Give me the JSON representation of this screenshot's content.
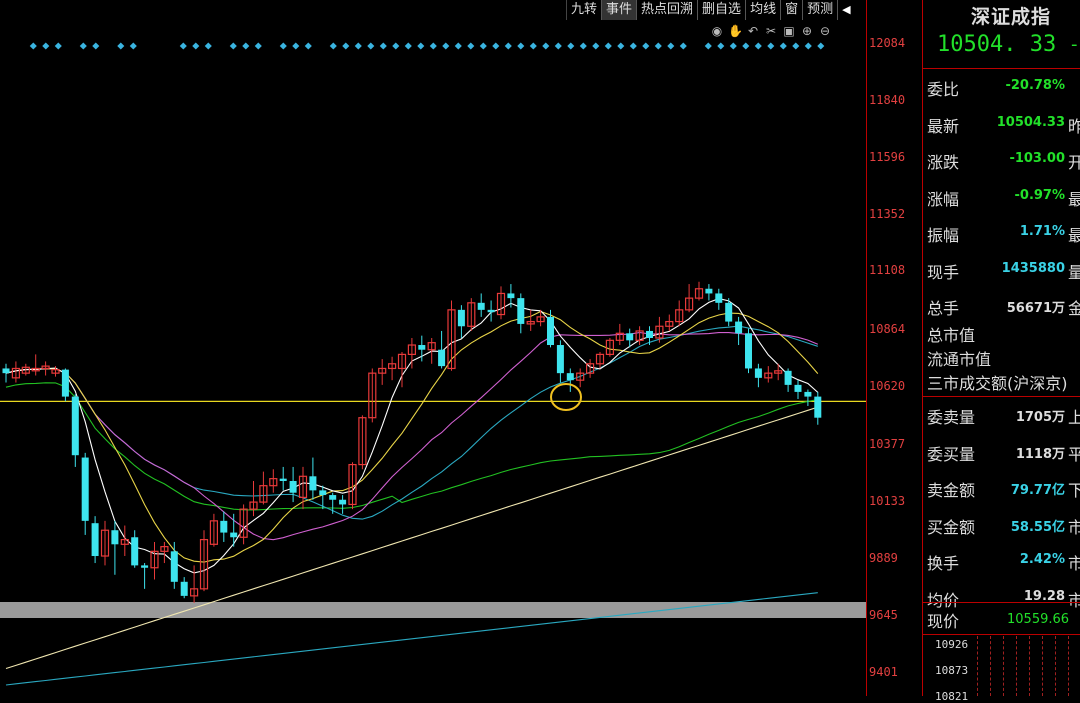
{
  "toolbar": {
    "buttons": [
      "九转",
      "事件",
      "热点回溯",
      "删自选",
      "均线",
      "窗",
      "预测"
    ],
    "active_index": 1,
    "collapse_label": "◀"
  },
  "tools": [
    "eye-icon",
    "hand-icon",
    "undo-icon",
    "scissors-icon",
    "lock-icon",
    "zoom-in-icon",
    "zoom-out-icon"
  ],
  "colors": {
    "up": "#e83a3a",
    "down": "#3ee4ee",
    "ma5": "#ffffff",
    "ma10": "#e8d448",
    "ma20": "#d060d0",
    "ma60": "#22c022",
    "ma120": "#2aa8c0",
    "ma250": "#f0e6b0",
    "ref": "#e8d820"
  },
  "chart_data": {
    "type": "candlestick",
    "y_ticks": [
      "12084",
      "11840",
      "11596",
      "11352",
      "11108",
      "10864",
      "10620",
      "10377",
      "10133",
      "9889",
      "9645",
      "9401"
    ],
    "ylim": [
      9401,
      12084
    ],
    "reference_line": 10559.66,
    "candles": [
      [
        10700,
        10680,
        10720,
        10640
      ],
      [
        10660,
        10700,
        10730,
        10640
      ],
      [
        10680,
        10705,
        10720,
        10670
      ],
      [
        10690,
        10700,
        10760,
        10670
      ],
      [
        10700,
        10710,
        10730,
        10670
      ],
      [
        10680,
        10695,
        10710,
        10665
      ],
      [
        10695,
        10580,
        10700,
        10560
      ],
      [
        10580,
        10330,
        10590,
        10280
      ],
      [
        10320,
        10050,
        10340,
        9990
      ],
      [
        10040,
        9900,
        10070,
        9870
      ],
      [
        9900,
        10010,
        10050,
        9860
      ],
      [
        10010,
        9950,
        10050,
        9820
      ],
      [
        9950,
        9970,
        10030,
        9900
      ],
      [
        9980,
        9860,
        10010,
        9850
      ],
      [
        9860,
        9850,
        9870,
        9760
      ],
      [
        9850,
        9920,
        9960,
        9800
      ],
      [
        9920,
        9940,
        9960,
        9870
      ],
      [
        9920,
        9790,
        9960,
        9760
      ],
      [
        9790,
        9730,
        9810,
        9720
      ],
      [
        9730,
        9760,
        9860,
        9700
      ],
      [
        9760,
        9970,
        10010,
        9750
      ],
      [
        9950,
        10050,
        10080,
        9940
      ],
      [
        10050,
        10000,
        10090,
        9960
      ],
      [
        10000,
        9980,
        10080,
        9940
      ],
      [
        9980,
        10100,
        10120,
        9950
      ],
      [
        10100,
        10130,
        10220,
        10070
      ],
      [
        10130,
        10200,
        10260,
        10120
      ],
      [
        10200,
        10230,
        10270,
        10170
      ],
      [
        10230,
        10220,
        10280,
        10180
      ],
      [
        10220,
        10170,
        10280,
        10130
      ],
      [
        10150,
        10240,
        10280,
        10100
      ],
      [
        10240,
        10180,
        10320,
        10140
      ],
      [
        10180,
        10160,
        10200,
        10100
      ],
      [
        10160,
        10140,
        10170,
        10080
      ],
      [
        10140,
        10120,
        10160,
        10080
      ],
      [
        10120,
        10290,
        10300,
        10100
      ],
      [
        10290,
        10490,
        10500,
        10270
      ],
      [
        10490,
        10680,
        10700,
        10470
      ],
      [
        10680,
        10700,
        10740,
        10630
      ],
      [
        10700,
        10720,
        10750,
        10650
      ],
      [
        10700,
        10760,
        10770,
        10620
      ],
      [
        10760,
        10800,
        10830,
        10700
      ],
      [
        10800,
        10780,
        10840,
        10730
      ],
      [
        10780,
        10810,
        10830,
        10720
      ],
      [
        10780,
        10710,
        10860,
        10700
      ],
      [
        10700,
        10950,
        10990,
        10690
      ],
      [
        10950,
        10880,
        10970,
        10830
      ],
      [
        10880,
        10980,
        11000,
        10860
      ],
      [
        10980,
        10950,
        11020,
        10920
      ],
      [
        10950,
        10940,
        10990,
        10900
      ],
      [
        10930,
        11020,
        11050,
        10910
      ],
      [
        11020,
        11000,
        11060,
        10960
      ],
      [
        11000,
        10890,
        11020,
        10850
      ],
      [
        10890,
        10900,
        10950,
        10860
      ],
      [
        10900,
        10920,
        10950,
        10880
      ],
      [
        10920,
        10800,
        10950,
        10790
      ],
      [
        10800,
        10680,
        10820,
        10640
      ],
      [
        10680,
        10650,
        10700,
        10600
      ],
      [
        10650,
        10680,
        10700,
        10620
      ],
      [
        10680,
        10720,
        10740,
        10660
      ],
      [
        10720,
        10760,
        10770,
        10700
      ],
      [
        10760,
        10820,
        10830,
        10750
      ],
      [
        10820,
        10850,
        10890,
        10800
      ],
      [
        10850,
        10820,
        10870,
        10790
      ],
      [
        10820,
        10860,
        10880,
        10800
      ],
      [
        10860,
        10830,
        10880,
        10800
      ],
      [
        10830,
        10880,
        10920,
        10810
      ],
      [
        10880,
        10900,
        10930,
        10860
      ],
      [
        10900,
        10950,
        10990,
        10880
      ],
      [
        10950,
        11000,
        11060,
        10940
      ],
      [
        11000,
        11040,
        11070,
        10990
      ],
      [
        11040,
        11020,
        11060,
        10990
      ],
      [
        11020,
        10980,
        11040,
        10950
      ],
      [
        10980,
        10900,
        11000,
        10880
      ],
      [
        10900,
        10850,
        10920,
        10800
      ],
      [
        10850,
        10700,
        10870,
        10680
      ],
      [
        10700,
        10660,
        10720,
        10620
      ],
      [
        10660,
        10680,
        10710,
        10640
      ],
      [
        10680,
        10690,
        10720,
        10650
      ],
      [
        10690,
        10630,
        10700,
        10600
      ],
      [
        10630,
        10600,
        10650,
        10570
      ],
      [
        10600,
        10580,
        10610,
        10540
      ],
      [
        10580,
        10490,
        10600,
        10460
      ]
    ]
  },
  "sidebar": {
    "title": "深证成指",
    "price": "10504. 33",
    "price_tail": "-",
    "rows": [
      {
        "label": "委比",
        "value": "-20.78%",
        "color": "g",
        "tail": ""
      },
      {
        "label": "最新",
        "value": "10504.33",
        "color": "g",
        "tail": "昨"
      },
      {
        "label": "涨跌",
        "value": "-103.00",
        "color": "g",
        "tail": "开"
      },
      {
        "label": "涨幅",
        "value": "-0.97%",
        "color": "g",
        "tail": "最"
      },
      {
        "label": "振幅",
        "value": "1.71%",
        "color": "c",
        "tail": "最"
      },
      {
        "label": "现手",
        "value": "1435880",
        "color": "c",
        "tail": "量"
      },
      {
        "label": "总手",
        "value": "56671万",
        "color": "w",
        "tail": "金"
      }
    ],
    "plain_rows": [
      "总市值",
      "流通市值",
      "三市成交额(沪深京)"
    ],
    "rows2": [
      {
        "label": "委卖量",
        "value": "1705万",
        "color": "w",
        "tail": "上"
      },
      {
        "label": "委买量",
        "value": "1118万",
        "color": "w",
        "tail": "平"
      },
      {
        "label": "卖金额",
        "value": "79.77亿",
        "color": "c",
        "tail": "下"
      },
      {
        "label": "买金额",
        "value": "58.55亿",
        "color": "c",
        "tail": "市"
      },
      {
        "label": "换手",
        "value": "2.42%",
        "color": "c",
        "tail": "市"
      },
      {
        "label": "均价",
        "value": "19.28",
        "color": "w",
        "tail": "市"
      }
    ],
    "current_label": "现价",
    "current_value": "10559.66",
    "mini_ticks": [
      "10926",
      "10873",
      "10821"
    ]
  }
}
